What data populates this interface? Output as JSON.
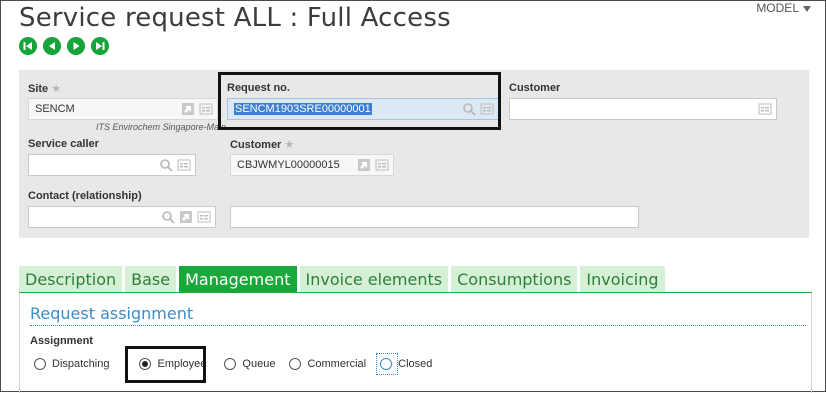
{
  "page": {
    "title": "Service request ALL : Full Access",
    "model_label": "MODEL"
  },
  "nav": {
    "buttons": [
      "first-record-icon",
      "previous-record-icon",
      "next-record-icon",
      "last-record-icon"
    ],
    "color": "#16a33a"
  },
  "form": {
    "site": {
      "label": "Site",
      "value": "SENCM",
      "caption": "ITS Envirochem Singapore-Main"
    },
    "request_no": {
      "label": "Request no.",
      "value": "SENCM1903SRE00000001"
    },
    "customer_top": {
      "label": "Customer",
      "value": ""
    },
    "service_caller": {
      "label": "Service caller",
      "value": ""
    },
    "customer": {
      "label": "Customer",
      "value": "CBJWMYL00000015"
    },
    "contact": {
      "label": "Contact (relationship)",
      "value": "",
      "description": ""
    }
  },
  "tabs": [
    {
      "label": "Description",
      "active": false
    },
    {
      "label": "Base",
      "active": false
    },
    {
      "label": "Management",
      "active": true
    },
    {
      "label": "Invoice elements",
      "active": false
    },
    {
      "label": "Consumptions",
      "active": false
    },
    {
      "label": "Invoicing",
      "active": false
    }
  ],
  "section": {
    "title": "Request assignment",
    "assignment_label": "Assignment",
    "options": [
      {
        "label": "Dispatching",
        "checked": false
      },
      {
        "label": "Employee",
        "checked": true
      },
      {
        "label": "Queue",
        "checked": false
      },
      {
        "label": "Commercial",
        "checked": false
      },
      {
        "label": "Closed",
        "checked": false
      }
    ]
  },
  "colors": {
    "accent_green": "#1aa83a",
    "section_blue": "#3a8dc9",
    "selection_blue": "#3d7fd6"
  }
}
